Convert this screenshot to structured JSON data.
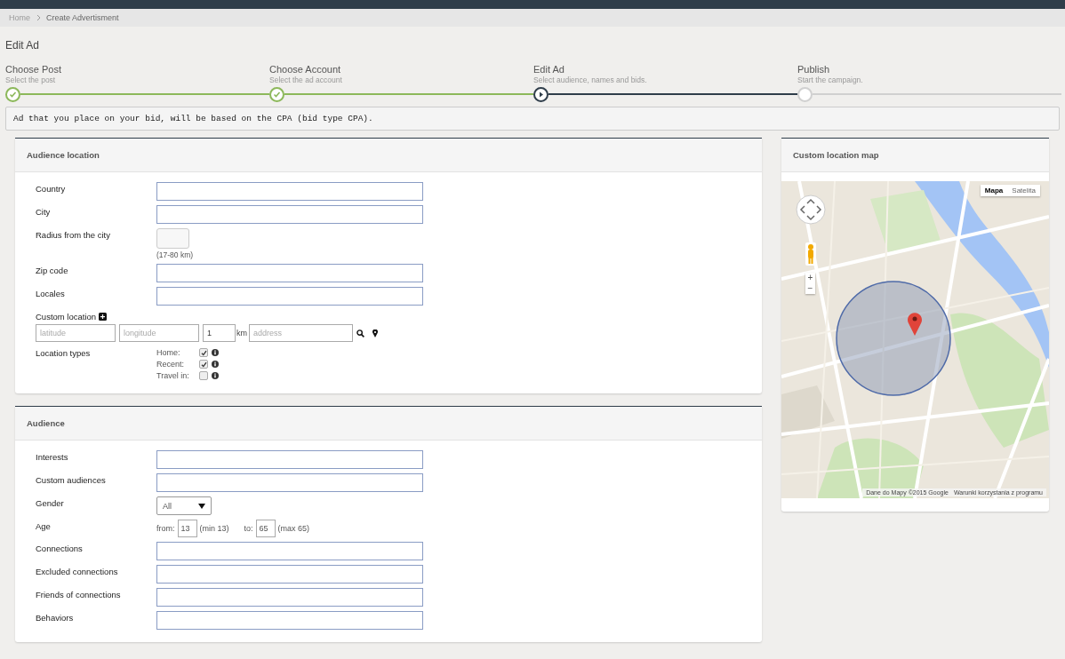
{
  "breadcrumb": [
    {
      "label": "Home"
    },
    {
      "label": "Create Advertisment"
    }
  ],
  "page_title": "Edit Ad",
  "steps": [
    {
      "title": "Choose Post",
      "subtitle": "Select the post",
      "kind": "done"
    },
    {
      "title": "Choose Account",
      "subtitle": "Select the ad account",
      "kind": "done"
    },
    {
      "title": "Edit Ad",
      "subtitle": "Select audience, names and bids.",
      "kind": "current"
    },
    {
      "title": "Publish",
      "subtitle": "Start the campaign.",
      "kind": "pending"
    }
  ],
  "notice": "Ad that you place on your bid, will be based on the CPA (bid type CPA).",
  "location_panel": {
    "title": "Audience location",
    "rows": [
      {
        "kind": "text",
        "label": "Country"
      },
      {
        "kind": "text",
        "label": "City"
      },
      {
        "kind": "radius",
        "label": "Radius from the city",
        "hint": "(17-80 km)"
      },
      {
        "kind": "text",
        "label": "Zip code"
      },
      {
        "kind": "text",
        "label": "Locales"
      },
      {
        "kind": "custom_location",
        "label": "Custom location",
        "latitude_placeholder": "latitude",
        "longitude_placeholder": "longitude",
        "radius_value": "1",
        "unit": "km",
        "address_placeholder": "address"
      },
      {
        "kind": "checkboxes",
        "label": "Location types",
        "options": [
          {
            "label": "Home:",
            "checked": true
          },
          {
            "label": "Recent:",
            "checked": true
          },
          {
            "label": "Travel in:",
            "checked": false
          }
        ]
      }
    ]
  },
  "audience_panel": {
    "title": "Audience",
    "rows": [
      {
        "kind": "text",
        "label": "Interests"
      },
      {
        "kind": "text",
        "label": "Custom audiences"
      },
      {
        "kind": "select",
        "label": "Gender",
        "value": "All"
      },
      {
        "kind": "age",
        "label": "Age",
        "from_label": "from:",
        "from_value": "13",
        "min_hint": "(min 13)",
        "to_label": "to:",
        "to_value": "65",
        "max_hint": "(max 65)"
      },
      {
        "kind": "text",
        "label": "Connections"
      },
      {
        "kind": "text",
        "label": "Excluded connections"
      },
      {
        "kind": "text",
        "label": "Friends of connections"
      },
      {
        "kind": "text",
        "label": "Behaviors"
      }
    ]
  },
  "map_panel": {
    "title": "Custom location map",
    "map_types": [
      {
        "label": "Mapa",
        "selected": true
      },
      {
        "label": "Satelita",
        "selected": false
      }
    ],
    "zoom_in": "+",
    "zoom_out": "−",
    "attribution": [
      "Dane do Mapy ©2015 Google",
      "Warunki korzystania z programu"
    ]
  }
}
